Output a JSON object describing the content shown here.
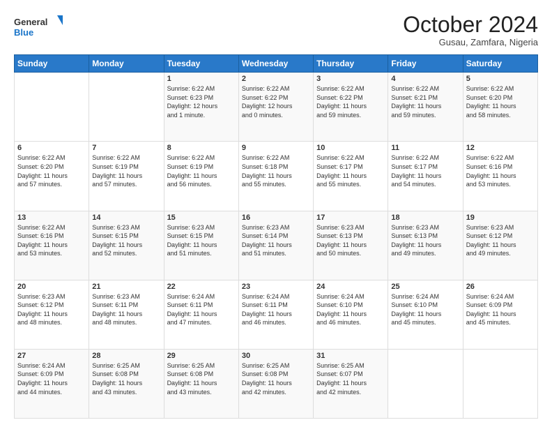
{
  "header": {
    "title": "October 2024",
    "subtitle": "Gusau, Zamfara, Nigeria",
    "logo_line1": "General",
    "logo_line2": "Blue"
  },
  "days_of_week": [
    "Sunday",
    "Monday",
    "Tuesday",
    "Wednesday",
    "Thursday",
    "Friday",
    "Saturday"
  ],
  "weeks": [
    [
      {
        "day": "",
        "info": ""
      },
      {
        "day": "",
        "info": ""
      },
      {
        "day": "1",
        "info": "Sunrise: 6:22 AM\nSunset: 6:23 PM\nDaylight: 12 hours\nand 1 minute."
      },
      {
        "day": "2",
        "info": "Sunrise: 6:22 AM\nSunset: 6:22 PM\nDaylight: 12 hours\nand 0 minutes."
      },
      {
        "day": "3",
        "info": "Sunrise: 6:22 AM\nSunset: 6:22 PM\nDaylight: 11 hours\nand 59 minutes."
      },
      {
        "day": "4",
        "info": "Sunrise: 6:22 AM\nSunset: 6:21 PM\nDaylight: 11 hours\nand 59 minutes."
      },
      {
        "day": "5",
        "info": "Sunrise: 6:22 AM\nSunset: 6:20 PM\nDaylight: 11 hours\nand 58 minutes."
      }
    ],
    [
      {
        "day": "6",
        "info": "Sunrise: 6:22 AM\nSunset: 6:20 PM\nDaylight: 11 hours\nand 57 minutes."
      },
      {
        "day": "7",
        "info": "Sunrise: 6:22 AM\nSunset: 6:19 PM\nDaylight: 11 hours\nand 57 minutes."
      },
      {
        "day": "8",
        "info": "Sunrise: 6:22 AM\nSunset: 6:19 PM\nDaylight: 11 hours\nand 56 minutes."
      },
      {
        "day": "9",
        "info": "Sunrise: 6:22 AM\nSunset: 6:18 PM\nDaylight: 11 hours\nand 55 minutes."
      },
      {
        "day": "10",
        "info": "Sunrise: 6:22 AM\nSunset: 6:17 PM\nDaylight: 11 hours\nand 55 minutes."
      },
      {
        "day": "11",
        "info": "Sunrise: 6:22 AM\nSunset: 6:17 PM\nDaylight: 11 hours\nand 54 minutes."
      },
      {
        "day": "12",
        "info": "Sunrise: 6:22 AM\nSunset: 6:16 PM\nDaylight: 11 hours\nand 53 minutes."
      }
    ],
    [
      {
        "day": "13",
        "info": "Sunrise: 6:22 AM\nSunset: 6:16 PM\nDaylight: 11 hours\nand 53 minutes."
      },
      {
        "day": "14",
        "info": "Sunrise: 6:23 AM\nSunset: 6:15 PM\nDaylight: 11 hours\nand 52 minutes."
      },
      {
        "day": "15",
        "info": "Sunrise: 6:23 AM\nSunset: 6:15 PM\nDaylight: 11 hours\nand 51 minutes."
      },
      {
        "day": "16",
        "info": "Sunrise: 6:23 AM\nSunset: 6:14 PM\nDaylight: 11 hours\nand 51 minutes."
      },
      {
        "day": "17",
        "info": "Sunrise: 6:23 AM\nSunset: 6:13 PM\nDaylight: 11 hours\nand 50 minutes."
      },
      {
        "day": "18",
        "info": "Sunrise: 6:23 AM\nSunset: 6:13 PM\nDaylight: 11 hours\nand 49 minutes."
      },
      {
        "day": "19",
        "info": "Sunrise: 6:23 AM\nSunset: 6:12 PM\nDaylight: 11 hours\nand 49 minutes."
      }
    ],
    [
      {
        "day": "20",
        "info": "Sunrise: 6:23 AM\nSunset: 6:12 PM\nDaylight: 11 hours\nand 48 minutes."
      },
      {
        "day": "21",
        "info": "Sunrise: 6:23 AM\nSunset: 6:11 PM\nDaylight: 11 hours\nand 48 minutes."
      },
      {
        "day": "22",
        "info": "Sunrise: 6:24 AM\nSunset: 6:11 PM\nDaylight: 11 hours\nand 47 minutes."
      },
      {
        "day": "23",
        "info": "Sunrise: 6:24 AM\nSunset: 6:11 PM\nDaylight: 11 hours\nand 46 minutes."
      },
      {
        "day": "24",
        "info": "Sunrise: 6:24 AM\nSunset: 6:10 PM\nDaylight: 11 hours\nand 46 minutes."
      },
      {
        "day": "25",
        "info": "Sunrise: 6:24 AM\nSunset: 6:10 PM\nDaylight: 11 hours\nand 45 minutes."
      },
      {
        "day": "26",
        "info": "Sunrise: 6:24 AM\nSunset: 6:09 PM\nDaylight: 11 hours\nand 45 minutes."
      }
    ],
    [
      {
        "day": "27",
        "info": "Sunrise: 6:24 AM\nSunset: 6:09 PM\nDaylight: 11 hours\nand 44 minutes."
      },
      {
        "day": "28",
        "info": "Sunrise: 6:25 AM\nSunset: 6:08 PM\nDaylight: 11 hours\nand 43 minutes."
      },
      {
        "day": "29",
        "info": "Sunrise: 6:25 AM\nSunset: 6:08 PM\nDaylight: 11 hours\nand 43 minutes."
      },
      {
        "day": "30",
        "info": "Sunrise: 6:25 AM\nSunset: 6:08 PM\nDaylight: 11 hours\nand 42 minutes."
      },
      {
        "day": "31",
        "info": "Sunrise: 6:25 AM\nSunset: 6:07 PM\nDaylight: 11 hours\nand 42 minutes."
      },
      {
        "day": "",
        "info": ""
      },
      {
        "day": "",
        "info": ""
      }
    ]
  ]
}
